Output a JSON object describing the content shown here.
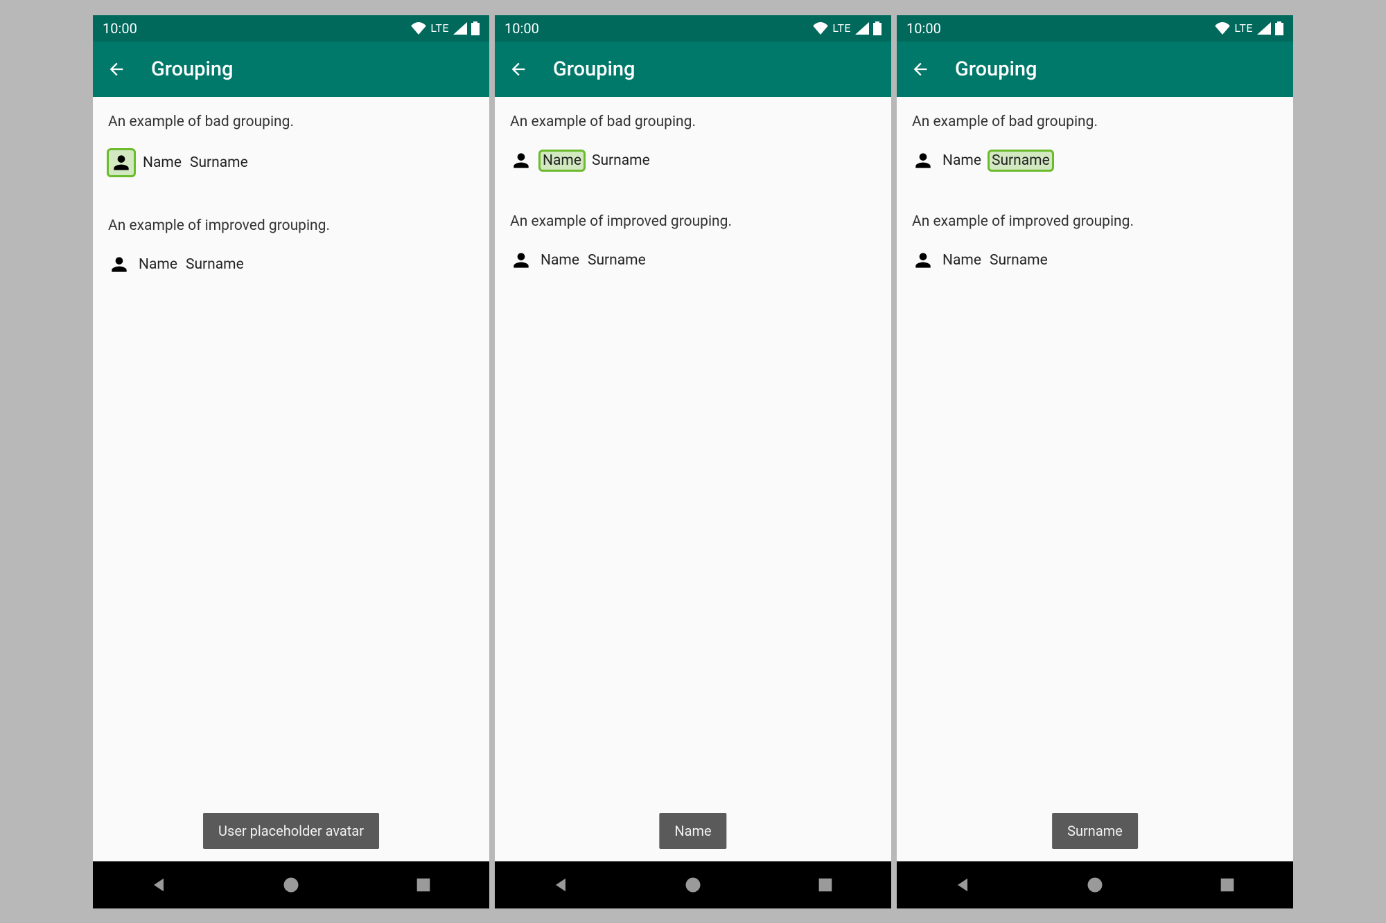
{
  "status": {
    "time": "10:00",
    "network": "LTE"
  },
  "appbar": {
    "title": "Grouping"
  },
  "sections": {
    "bad_label": "An example of bad grouping.",
    "improved_label": "An example of improved grouping."
  },
  "person": {
    "name": "Name",
    "surname": "Surname"
  },
  "toasts": {
    "s0": "User placeholder avatar",
    "s1": "Name",
    "s2": "Surname"
  },
  "colors": {
    "primary": "#00796b",
    "primary_dark": "#00695c",
    "highlight": "#6bbb2c"
  }
}
